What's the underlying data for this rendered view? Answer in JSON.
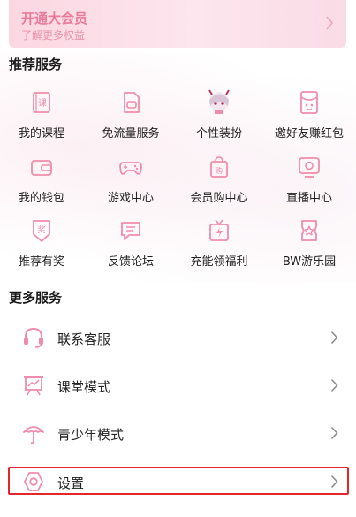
{
  "colors": {
    "accent": "#f08cab",
    "vip_text": "#e87a9a",
    "highlight": "#e3252e"
  },
  "vip": {
    "title": "开通大会员",
    "subtitle": "了解更多权益"
  },
  "recommended": {
    "title": "推荐服务",
    "items": [
      {
        "label": "我的课程",
        "icon": "course-book-icon"
      },
      {
        "label": "免流量服务",
        "icon": "sim-card-icon"
      },
      {
        "label": "个性装扮",
        "icon": "anime-avatar-icon"
      },
      {
        "label": "邀好友赚红包",
        "icon": "red-envelope-icon"
      },
      {
        "label": "我的钱包",
        "icon": "wallet-icon"
      },
      {
        "label": "游戏中心",
        "icon": "gamepad-icon"
      },
      {
        "label": "会员购中心",
        "icon": "shopping-bag-icon"
      },
      {
        "label": "直播中心",
        "icon": "live-tv-icon"
      },
      {
        "label": "推荐有奖",
        "icon": "reward-badge-icon"
      },
      {
        "label": "反馈论坛",
        "icon": "feedback-bubble-icon"
      },
      {
        "label": "充能领福利",
        "icon": "charge-gift-icon"
      },
      {
        "label": "BW游乐园",
        "icon": "bw-park-icon"
      }
    ]
  },
  "more": {
    "title": "更多服务",
    "items": [
      {
        "label": "联系客服",
        "icon": "headset-icon"
      },
      {
        "label": "课堂模式",
        "icon": "classroom-icon"
      },
      {
        "label": "青少年模式",
        "icon": "umbrella-icon"
      },
      {
        "label": "设置",
        "icon": "settings-icon"
      }
    ]
  }
}
